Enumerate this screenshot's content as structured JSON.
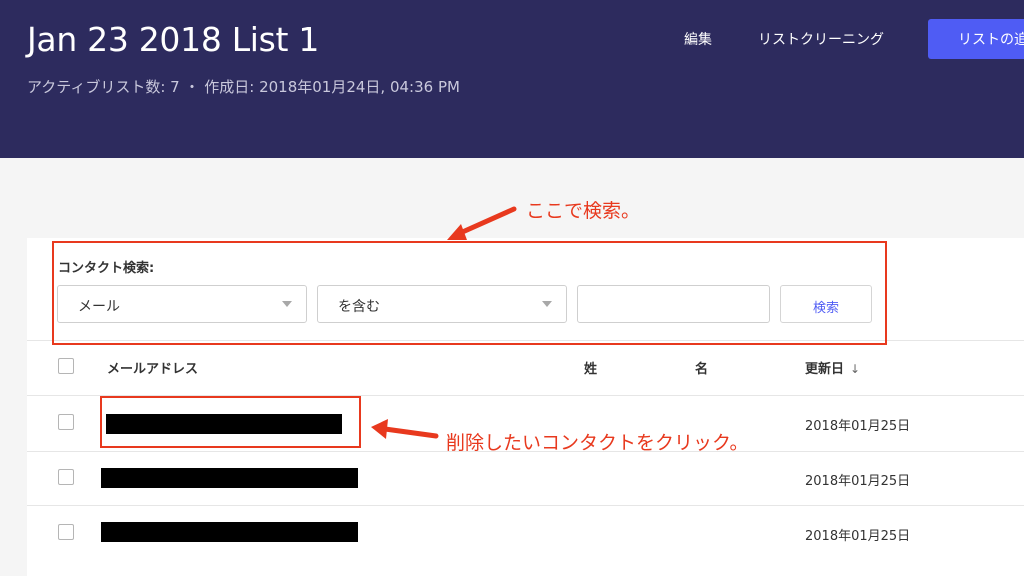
{
  "header": {
    "title": "Jan 23 2018 List 1",
    "subtitle": "アクティブリスト数: 7 ・ 作成日: 2018年01月24日, 04:36 PM",
    "nav": {
      "edit": "編集",
      "list_cleaning": "リストクリーニング",
      "add_list": "リストの追加"
    }
  },
  "search": {
    "label": "コンタクト検索:",
    "field_select": "メール",
    "operator_select": "を含む",
    "value": "",
    "button": "検索"
  },
  "table": {
    "columns": {
      "email": "メールアドレス",
      "last_name": "姓",
      "first_name": "名",
      "updated": "更新日",
      "sort_indicator": "↓"
    },
    "rows": [
      {
        "email": "[redacted]",
        "updated": "2018年01月25日"
      },
      {
        "email": "[redacted]",
        "updated": "2018年01月25日"
      },
      {
        "email": "[redacted]",
        "updated": "2018年01月25日"
      }
    ]
  },
  "annotations": {
    "search_here": "ここで検索。",
    "click_contact": "削除したいコンタクトをクリック。",
    "color": "#e8391e"
  },
  "colors": {
    "header_bg": "#2d2b5e",
    "accent": "#4f5cf4"
  }
}
